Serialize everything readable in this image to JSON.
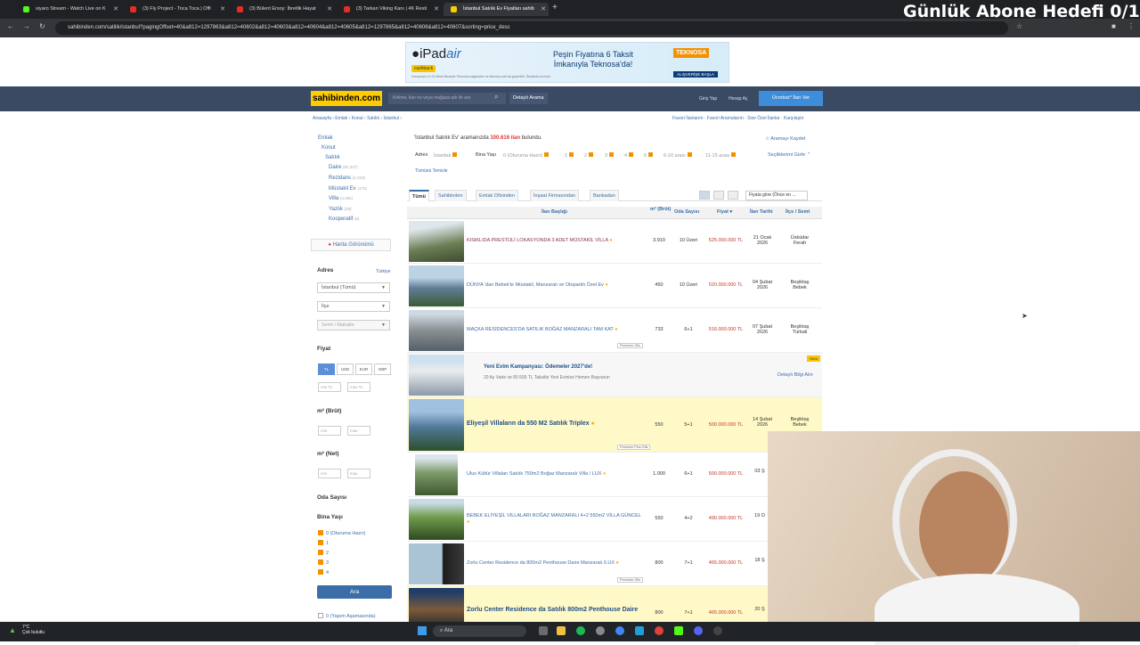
{
  "browser": {
    "tabs": [
      {
        "label": "siyaro Stream - Watch Live on K"
      },
      {
        "label": "(3) Fly Project - Toca Toca | Offi"
      },
      {
        "label": "(3) Bülent Ersoy: İbretlik Hayat"
      },
      {
        "label": "(3) Tarkan Viking Kanı | 4K Resti"
      },
      {
        "label": "İstanbul Satılık Ev Fiyatları sahib"
      }
    ],
    "url": "sahibinden.com/satilik/istanbul?pagingOffset=40&a812=1297863&a812=40602&a812=40603&a812=40604&a812=40605&a812=1297865&a812=40606&a812=40607&sorting=price_desc"
  },
  "stream": {
    "title": "Günlük Abone Hedefi 0/1"
  },
  "ad": {
    "brand": "iPad",
    "model": "air",
    "tag": "cashback",
    "message": "Peşin Fiyatına 6 Taksit İmkanıyla Teknosa'da!",
    "store": "TEKNOSA",
    "cta": "ALIŞVERİŞE BAŞLA",
    "disclaimer": "Kampanya 14.01 itibari itibariyle Teknosa mağazaları ve teknosa.com'da geçerlidir. Stoklarla sınırlıdır."
  },
  "header": {
    "logo": "sahibinden.com",
    "search_placeholder": "Kelime, ilan no veya mağaza adı ile ara",
    "detailed": "Detaylı Arama",
    "login": "Giriş Yap",
    "register": "Hesap Aç",
    "post": "Ücretsiz* İlan Ver"
  },
  "breadcrumb": "Anasayfa › Emlak › Konut › Satılık › İstanbul ›",
  "toplinks": "Favori İlanlarım · Favori Aramalarım · Size Özel İlanlar · Karşılaştır",
  "sidebar": {
    "categories": [
      {
        "label": "Emlak",
        "count": ""
      },
      {
        "label": "Konut",
        "count": ""
      },
      {
        "label": "Satılık",
        "count": ""
      },
      {
        "label": "Daire",
        "count": "(91.337)"
      },
      {
        "label": "Rezidans",
        "count": "(4.318)"
      },
      {
        "label": "Müstakil Ev",
        "count": "(475)"
      },
      {
        "label": "Villa",
        "count": "(4.482)"
      },
      {
        "label": "Yazlık",
        "count": "(28)"
      },
      {
        "label": "Kooperatif",
        "count": "(6)"
      }
    ],
    "map": "Harita Görünümü",
    "adres_label": "Adres",
    "adres_scope": "Türkiye",
    "city": "İstanbul (Tümü)",
    "district": "İlçe",
    "neighborhood": "Semt / Mahalle",
    "fiyat_label": "Fiyat",
    "currencies": [
      "TL",
      "USD",
      "EUR",
      "GBP"
    ],
    "min_tl": "min TL",
    "max_tl": "max TL",
    "m2_brut": "m² (Brüt)",
    "m2_net": "m² (Net)",
    "min": "min",
    "max": "max",
    "oda": "Oda Sayısı",
    "bina": "Bina Yaşı",
    "bina_opts": [
      "0 (Oturuma Hazır)",
      "1",
      "2",
      "3",
      "4"
    ],
    "search_btn": "Ara",
    "extra_opt": "0 (Yapım Aşamasında)"
  },
  "results": {
    "found_pre": "'İstanbul Satılık Ev' aramanızda",
    "found_count": "100.616 ilan",
    "found_post": "bulundu.",
    "save": "☆ Aramayı Kaydet",
    "adres_label": "Adres",
    "adres_val": "İstanbul",
    "bina_label": "Bina Yaşı",
    "bina_chips": [
      "0 (Oturuma Hazır)",
      "1",
      "2",
      "3",
      "4",
      "5",
      "6-10 arası",
      "11-15 arası"
    ],
    "hide": "Seçtiklerimi Gizle ⌃",
    "clear": "Tümünü Temizle",
    "tabs": [
      "Tümü",
      "Sahibinden",
      "Emlak Ofisinden",
      "İnşaat Firmasından",
      "Bankadan"
    ],
    "sort": "Fiyata göre (Önce en ...",
    "headers": {
      "title": "İlan Başlığı",
      "m2": "m² (Brüt)",
      "oda": "Oda Sayısı",
      "price": "Fiyat ▾",
      "date": "İlan Tarihi",
      "loc": "İlçe / Semt"
    }
  },
  "listings": [
    {
      "title": "KISIKLIDA PRESTİJLİ LOKASYONDA 3 ADET MÜSTAKİL VİLLA",
      "m2": "3.910",
      "oda": "10 Üzeri",
      "price": "525.000.000 TL",
      "date": "21 Ocak 2026",
      "loc": "Üsküdar Ferah",
      "badge": ""
    },
    {
      "title": "DÜNYA 'dan Bebek'te Müstakil, Manzaralı ve Otoparklı Özel Ev",
      "m2": "450",
      "oda": "10 Üzeri",
      "price": "520.000.000 TL",
      "date": "04 Şubat 2026",
      "loc": "Beşiktaş Bebek",
      "badge": ""
    },
    {
      "title": "MAÇKA RESİDENCES'DA SATILIK BOĞAZ MANZARALI TAM KAT",
      "m2": "733",
      "oda": "6+1",
      "price": "516.000.000 TL",
      "date": "07 Şubat 2026",
      "loc": "Beşiktaş Türkali",
      "badge": "Premium Ofis"
    },
    {
      "title": "Eliyeşil Villaların da 550 M2 Satılık Triplex",
      "m2": "550",
      "oda": "5+1",
      "price": "500.000.000 TL",
      "date": "14 Şubat 2026",
      "loc": "Beşiktaş Bebek",
      "badge": "Premium Plus Ofis"
    },
    {
      "title": "Ulus Kültür Villaları Satılık 750m2 Boğaz Manzaralı Villa / LUX",
      "m2": "1.000",
      "oda": "6+1",
      "price": "500.000.000 TL",
      "date": "03 Ş",
      "loc": "",
      "badge": ""
    },
    {
      "title": "BEBEK ELİYEŞİL VİLLALARI BOĞAZ MANZARALI 4+2 550m2 VİLLA GÜNCEL",
      "m2": "550",
      "oda": "4+2",
      "price": "490.000.000 TL",
      "date": "19 O",
      "loc": "",
      "badge": ""
    },
    {
      "title": "Zorlu Center Residence da 800m2 Penthouse Daire Manzaralı /LUX",
      "m2": "800",
      "oda": "7+1",
      "price": "465.000.000 TL",
      "date": "18 Ş",
      "loc": "",
      "badge": "Premium Ofis"
    },
    {
      "title": "Zorlu Center Residence da Satılık 800m2 Penthouse Daire",
      "m2": "800",
      "oda": "7+1",
      "price": "465.000.000 TL",
      "date": "20 Ş",
      "loc": "",
      "badge": ""
    }
  ],
  "campaign": {
    "title": "Yeni Evim Kampanyası: Ödemeler 2027'de!",
    "sub": "20 Ay Vade ve 80.500 TL Taksitle Yeni Evinize Hemen Başvurun",
    "cta": "Detaylı Bilgi Alın",
    "badge": "Vitrin"
  },
  "taskbar": {
    "temp": "7°C",
    "weather": "Çok bulutlu",
    "search": "Ara"
  }
}
